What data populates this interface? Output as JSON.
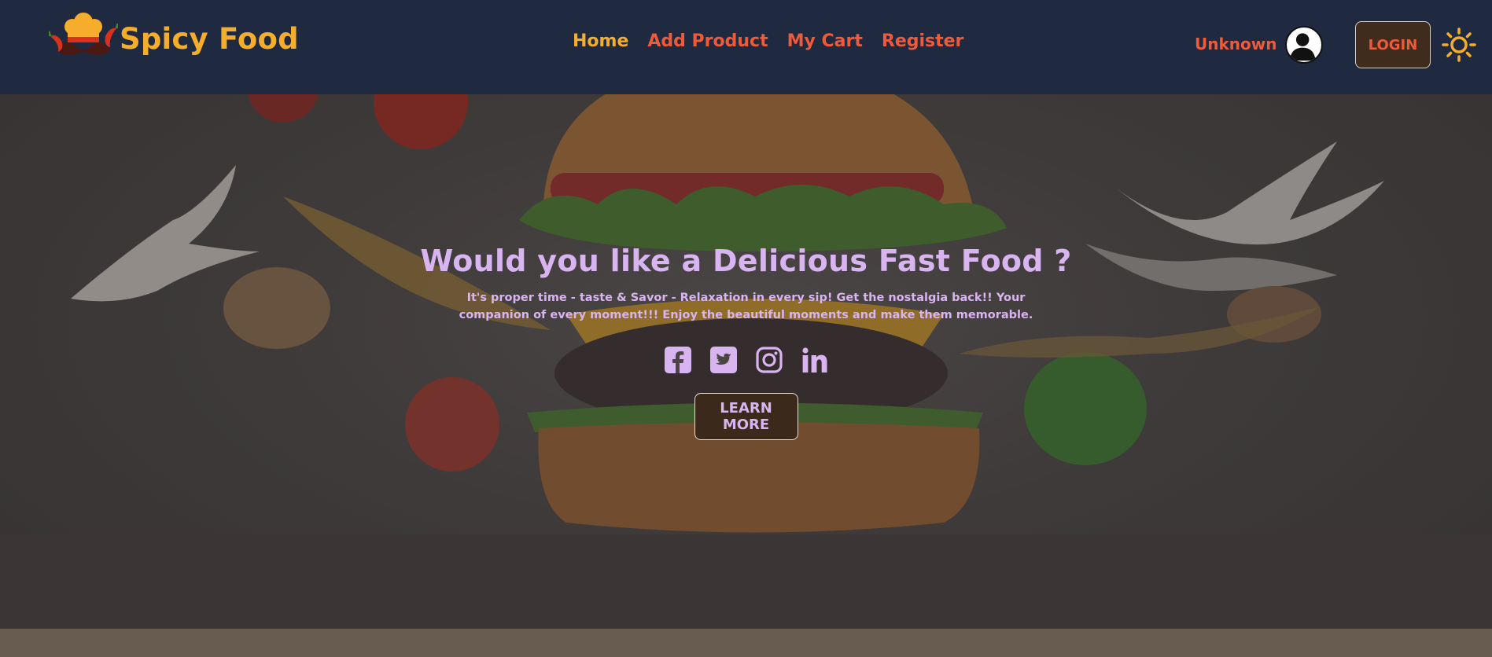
{
  "header": {
    "brand_name": "Spicy Food",
    "nav": {
      "home": "Home",
      "add_product": "Add Product",
      "my_cart": "My Cart",
      "register": "Register"
    },
    "user_name": "Unknown",
    "login_label": "LOGIN"
  },
  "hero": {
    "title": "Would you like a Delicious Fast Food ?",
    "subtitle": "It's proper time - taste & Savor - Relaxation in every sip! Get the nostalgia back!! Your companion of every moment!!! Enjoy the beautiful moments and make them memorable.",
    "cta_label": "LEARN MORE",
    "socials": [
      "facebook-icon",
      "twitter-icon",
      "instagram-icon",
      "linkedin-icon"
    ]
  },
  "colors": {
    "navbar_bg": "#1f2a40",
    "brand": "#f6ad2b",
    "nav_link": "#ef5a3a",
    "hero_text": "#d8b4f0",
    "button_bg": "#3f2c1c"
  }
}
